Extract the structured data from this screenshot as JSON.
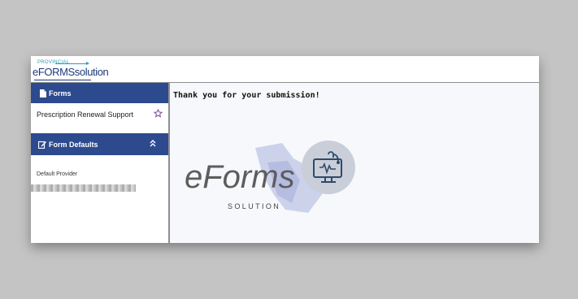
{
  "logo": {
    "provincial": "PROVINCIAL",
    "name": "eFORMSsolution"
  },
  "sidebar": {
    "forms_header": "Forms",
    "forms_icon": "document-icon",
    "items": [
      {
        "label": "Prescription Renewal Support",
        "icon": "star-outline-icon"
      }
    ],
    "defaults_header": "Form Defaults",
    "defaults_icon": "edit-icon",
    "collapse_icon": "chevron-double-up-icon",
    "provider_label": "Default Provider"
  },
  "main": {
    "message": "Thank you for your submission!",
    "brand": "eForms",
    "brand_sub": "SOLUTION",
    "illustration_icon": "monitor-stethoscope-icon"
  },
  "colors": {
    "header_bg": "#2d4a8f",
    "logo_blue": "#1d3a7a",
    "accent_teal": "#2a9db5",
    "star_purple": "#7a3d8f"
  }
}
